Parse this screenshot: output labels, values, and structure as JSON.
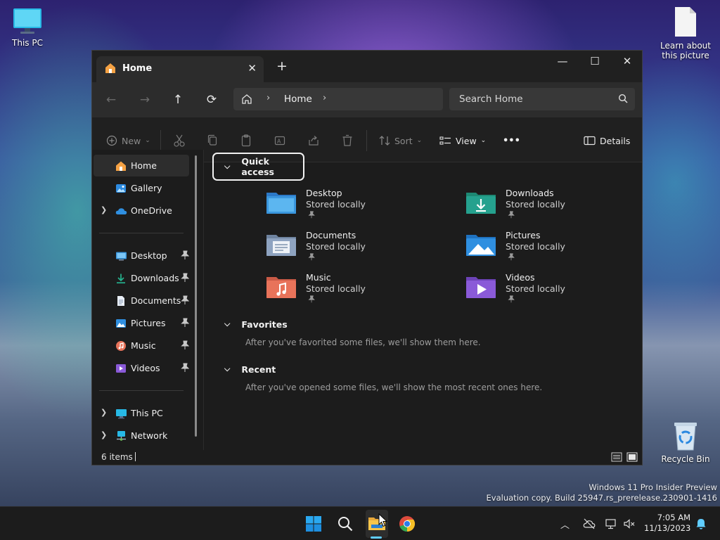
{
  "desktop": {
    "icons": [
      {
        "label": "This PC"
      },
      {
        "label": "Learn about this picture"
      },
      {
        "label": "Recycle Bin"
      }
    ],
    "watermark": {
      "line1": "Windows 11 Pro Insider Preview",
      "line2": "Evaluation copy. Build 25947.rs_prerelease.230901-1416"
    }
  },
  "window": {
    "tab": {
      "title": "Home",
      "close": "✕",
      "add": "+"
    },
    "controls": {
      "minimize": "—",
      "maximize": "☐",
      "close": "✕"
    },
    "nav": {
      "back": "←",
      "forward": "→",
      "up": "↑",
      "refresh": "⟳",
      "breadcrumb": "Home",
      "separator": "›",
      "search_placeholder": "Search Home"
    },
    "commands": {
      "new": "New",
      "sort": "Sort",
      "view": "View",
      "more": "•••",
      "details": "Details"
    },
    "sidebar": {
      "top": [
        {
          "label": "Home",
          "icon": "home-icon"
        },
        {
          "label": "Gallery",
          "icon": "gallery-icon"
        },
        {
          "label": "OneDrive",
          "icon": "cloud-icon"
        }
      ],
      "pinned": [
        {
          "label": "Desktop",
          "icon": "desktop-folder-icon"
        },
        {
          "label": "Downloads",
          "icon": "downloads-icon"
        },
        {
          "label": "Documents",
          "icon": "documents-icon"
        },
        {
          "label": "Pictures",
          "icon": "pictures-icon"
        },
        {
          "label": "Music",
          "icon": "music-icon"
        },
        {
          "label": "Videos",
          "icon": "videos-icon"
        }
      ],
      "bottom": [
        {
          "label": "This PC",
          "icon": "pc-icon"
        },
        {
          "label": "Network",
          "icon": "network-icon"
        }
      ]
    },
    "content": {
      "quick_access": {
        "title": "Quick access",
        "items": [
          {
            "name": "Desktop",
            "sub": "Stored locally",
            "color": "#3a96dd"
          },
          {
            "name": "Downloads",
            "sub": "Stored locally",
            "color": "#25a18e"
          },
          {
            "name": "Documents",
            "sub": "Stored locally",
            "color": "#8ea3c0"
          },
          {
            "name": "Pictures",
            "sub": "Stored locally",
            "color": "#2f8fe0"
          },
          {
            "name": "Music",
            "sub": "Stored locally",
            "color": "#e8735a"
          },
          {
            "name": "Videos",
            "sub": "Stored locally",
            "color": "#8a5ad8"
          }
        ]
      },
      "favorites": {
        "title": "Favorites",
        "message": "After you've favorited some files, we'll show them here."
      },
      "recent": {
        "title": "Recent",
        "message": "After you've opened some files, we'll show the most recent ones here."
      }
    },
    "status": {
      "count": "6 items"
    }
  },
  "taskbar": {
    "time": "7:05 AM",
    "date": "11/13/2023",
    "accent": "#60cdff"
  }
}
